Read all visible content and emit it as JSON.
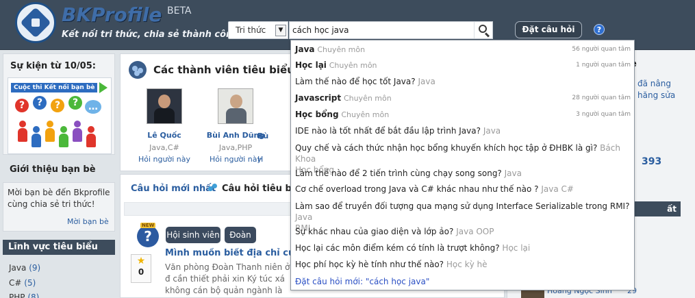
{
  "brand": {
    "name": "BKProfile",
    "beta": "BETA",
    "tagline": "Kết nối tri thức, chia sẻ thành công"
  },
  "search": {
    "category": "Tri thức",
    "query": "cách học java"
  },
  "header": {
    "ask_button": "Đặt câu hỏi",
    "help": "?"
  },
  "sidebar": {
    "event_title": "Sự kiện từ 10/05:",
    "event_banner": "Cuộc thi Kết nối bạn bè",
    "invite_title": "Giới thiệu bạn bè",
    "invite_text": "Mời bạn bè đến Bkprofile cùng chia sẻ tri thức!",
    "invite_link": "Mời bạn bè",
    "fields_title": "Lĩnh vực tiêu biểu",
    "fields": [
      {
        "name": "Java",
        "count": "(9)"
      },
      {
        "name": "C#",
        "count": "(5)"
      },
      {
        "name": "PHP",
        "count": "(8)"
      }
    ]
  },
  "members": {
    "title": "Các thành viên tiêu biểu",
    "items": [
      {
        "name": "Lê Quốc",
        "tags": "Java,C#",
        "ask": "Hỏi người này"
      },
      {
        "name": "Bùi Anh Dũng",
        "tags": "Java,PHP",
        "ask": "Hỏi người này"
      },
      {
        "name": "Bù",
        "tags": "",
        "ask": "H"
      }
    ]
  },
  "questions": {
    "tab_new": "Câu hỏi mới nhất",
    "tab_top": "Câu hỏi tiêu biểu",
    "item": {
      "tags": [
        "Hội sinh viên",
        "Đoàn"
      ],
      "votes": "0",
      "title": "Mình muốn biết địa chỉ của nh",
      "body": "Văn phòng Đoàn Thanh niên ở đ cần thiết phải xin Ký túc xá không cán bộ quản ngành là xin cụ thể ở đâu? :-s"
    }
  },
  "right": {
    "heading": "e",
    "text_line1": "đã nâng",
    "text_line2": "hăng sửa",
    "number": "393",
    "button": "ất",
    "user_name": "Hoàng Ngọc Sinh",
    "user_count": "29"
  },
  "autocomplete": {
    "items": [
      {
        "title": "Java",
        "category": "Chuyên môn",
        "followers": "56 người quan tâm",
        "bold": true
      },
      {
        "title": "Học lại",
        "category": "Chuyên môn",
        "followers": "1 người quan tâm",
        "bold": true
      },
      {
        "title": "Làm thế nào để học tốt Java?",
        "tags": "Java"
      },
      {
        "title": "Javascript",
        "category": "Chuyên môn",
        "followers": "28 người quan tâm",
        "bold": true
      },
      {
        "title": "Học bổng",
        "category": "Chuyên môn",
        "followers": "3 người quan tâm",
        "bold": true
      },
      {
        "title": "IDE nào là tốt nhất để bắt đầu lập trình Java?",
        "tags": "Java"
      },
      {
        "title": "Quy chế và cách thức nhận học bổng khuyến khích học tập ở ĐHBK là gì?",
        "tags": "Bách Khoa",
        "tags_line2": "Học bổng"
      },
      {
        "title": "Làm thế nào để 2 tiến trình cùng chạy song song?",
        "tags": "Java"
      },
      {
        "title": "Cơ chế overload trong Java và C# khác nhau như thế nào ?",
        "tags": "Java C#"
      },
      {
        "title": "Làm sao để truyền đối tượng qua mạng sử dụng Interface Serializable trong RMI?",
        "tags": "Java",
        "tags_line2": "RMI"
      },
      {
        "title": "Sự khác nhau của giao diện và lớp ảo?",
        "tags": "Java OOP"
      },
      {
        "title": "Học lại các môn điểm kém có tính là trượt không?",
        "tags": "Học lại"
      },
      {
        "title": "Học phí học kỳ hè tính như thế nào?",
        "tags": "Học kỳ hè"
      }
    ],
    "new_question": "Đặt câu hỏi mới: \"cách học java\""
  }
}
